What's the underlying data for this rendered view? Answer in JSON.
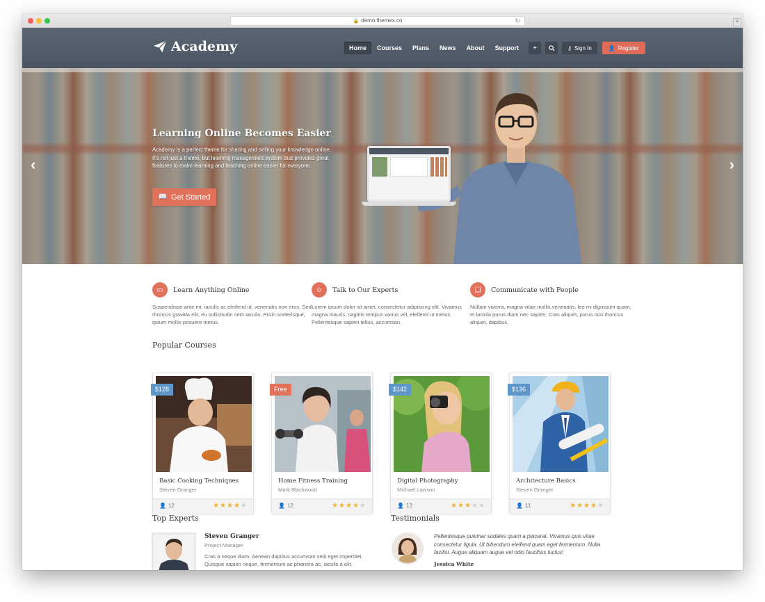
{
  "browser": {
    "url": "demo.themex.co"
  },
  "header": {
    "logo": "Academy",
    "nav": [
      "Home",
      "Courses",
      "Plans",
      "News",
      "About",
      "Support"
    ],
    "signin": "Sign In",
    "register": "Register"
  },
  "hero": {
    "title": "Learning Online Becomes Easier",
    "text": "Academy is a perfect theme for sharing and selling your knowledge online. It's not just a theme, but learning management system that provides great features to make learning and teaching online easier for everyone.",
    "button": "Get Started"
  },
  "features": [
    {
      "title": "Learn Anything Online",
      "text": "Suspendisse ante mi, iaculis ac eleifend id, venenatis non eros. Sed rhoncus gravida elit, eu sollicitudin sem iaculis. Proin scelerisque, ipsum mollis posuere metus."
    },
    {
      "title": "Talk to Our Experts",
      "text": "Lorem ipsum dolor sit amet, consectetur adipiscing elit. Vivamus magna mauris, sagittis tempus varius vel, eleifend ut metus. Pellentesque sapien tellus, accumsan."
    },
    {
      "title": "Communicate with People",
      "text": "Nullam viverra, magna vitae mollis venenatis, leo mi dignissim quam, et lacinia purus diam nec sapien. Cras aliquet, purus non rhoncus aliquet, dapibus."
    }
  ],
  "popular_title": "Popular Courses",
  "courses": [
    {
      "price": "$128",
      "title": "Basic Cooking Techniques",
      "author": "Steven Granger",
      "users": "12",
      "rating": 4
    },
    {
      "price": "Free",
      "title": "Home Fitness Training",
      "author": "Mark Blackwood",
      "users": "12",
      "rating": 4
    },
    {
      "price": "$142",
      "title": "Digital Photography",
      "author": "Michael Lawson",
      "users": "12",
      "rating": 3
    },
    {
      "price": "$136",
      "title": "Architecture Basics",
      "author": "Steven Granger",
      "users": "11",
      "rating": 4
    }
  ],
  "experts_title": "Top Experts",
  "expert": {
    "name": "Steven Granger",
    "role": "Project Manager",
    "text": "Cras a neque diam. Aenean dapibus accumsan velit eget imperdiet. Quisque sapien neque, fermentum ac pharetra ac, iaculis a elit."
  },
  "testimonials_title": "Testimonials",
  "testimonial": {
    "text": "Pellentesque pulvinar sodales quam a placerat. Vivamus quis vitae consectetur ligula. Ut bibendum eleifend quam eget fermentum. Nulla facilisi. Augue aliquam augue vel odio faucibus luctus!",
    "author": "Jessica White"
  },
  "colors": {
    "accent": "#e2715c",
    "header": "#4b5562",
    "price_blue": "#5f96c9",
    "star": "#f2b233"
  }
}
